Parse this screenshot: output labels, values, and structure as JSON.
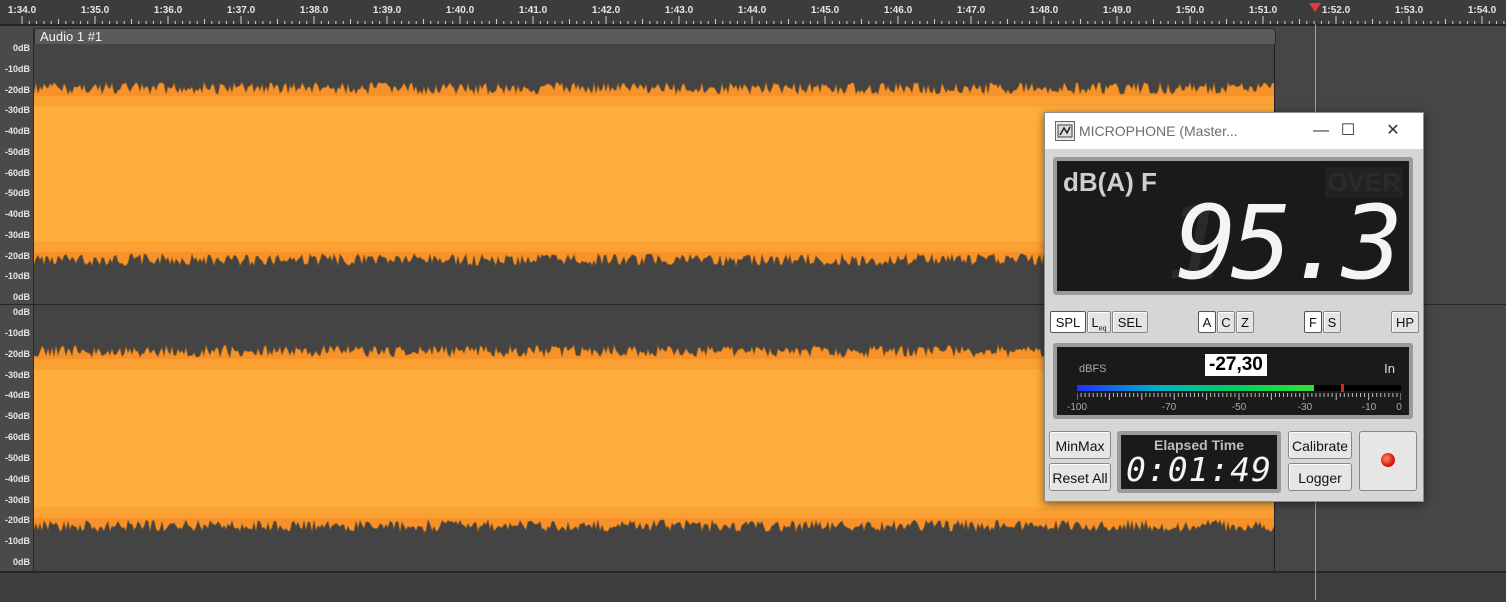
{
  "ruler": {
    "labels": [
      "1:34.0",
      "1:35.0",
      "1:36.0",
      "1:37.0",
      "1:38.0",
      "1:39.0",
      "1:40.0",
      "1:41.0",
      "1:42.0",
      "1:43.0",
      "1:44.0",
      "1:45.0",
      "1:46.0",
      "1:47.0",
      "1:48.0",
      "1:49.0",
      "1:50.0",
      "1:51.0",
      "1:52.0",
      "1:53.0",
      "1:54.0"
    ]
  },
  "track": {
    "title": "Audio 1 #1",
    "db_labels_top": [
      "0dB",
      "-10dB",
      "-20dB",
      "-30dB",
      "-40dB",
      "-50dB",
      "-60dB",
      "-50dB",
      "-40dB",
      "-30dB",
      "-20dB",
      "-10dB",
      "0dB"
    ],
    "db_labels_bottom": [
      "0dB",
      "-10dB",
      "-20dB",
      "-30dB",
      "-40dB",
      "-50dB",
      "-60dB",
      "-50dB",
      "-40dB",
      "-30dB",
      "-20dB",
      "-10dB",
      "0dB"
    ],
    "waveform_color": "#ffad3c",
    "waveform_edge_color": "#f7922a"
  },
  "spl_window": {
    "title": "MICROPHONE (Master...",
    "minimize": "—",
    "maximize": "☐",
    "close": "✕",
    "mode": "dB(A) F",
    "over": "OVER",
    "value": "95.3",
    "buttons": {
      "spl": "SPL",
      "leq_main": "L",
      "leq_sub": "eq",
      "sel": "SEL",
      "a": "A",
      "c": "C",
      "z": "Z",
      "f": "F",
      "s": "S",
      "hp": "HP"
    },
    "meter": {
      "unit": "dBFS",
      "value": "-27,30",
      "input": "In",
      "scale": [
        "-100",
        "-70",
        "-50",
        "-30",
        "-10",
        "0"
      ],
      "level_fraction": 0.73,
      "peak_fraction": 0.815
    },
    "elapsed_label": "Elapsed Time",
    "elapsed_value": "0:01:49",
    "minmax": "MinMax",
    "reset_all": "Reset All",
    "calibrate": "Calibrate",
    "logger": "Logger"
  }
}
